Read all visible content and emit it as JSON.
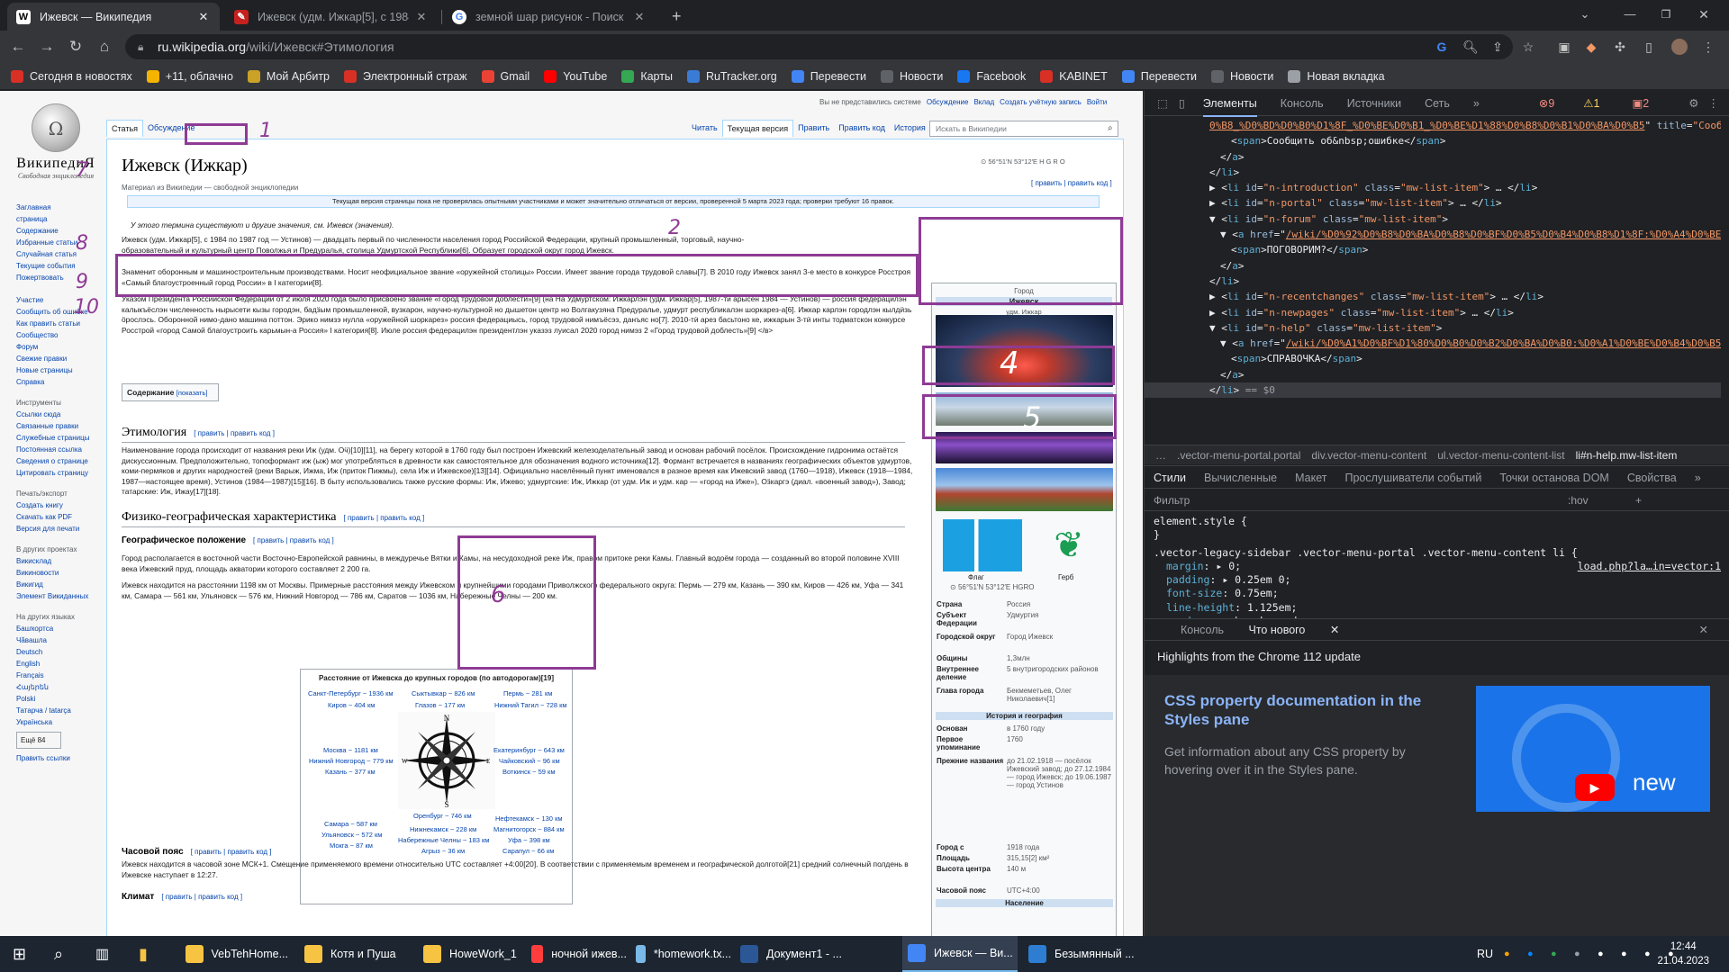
{
  "browser": {
    "tabs": [
      {
        "title": "Ижевск — Википедия",
        "icon": "W",
        "active": true
      },
      {
        "title": "Ижевск (удм. Ижкар[5], с 1984 …",
        "icon": "wiki-edit"
      },
      {
        "title": "земной шар рисунок - Поиск в…",
        "icon": "G"
      }
    ],
    "new_tab": "+",
    "url_host": "ru.wikipedia.org",
    "url_path": "/wiki/Ижевск#Этимология",
    "bookmarks": [
      {
        "label": "Сегодня в новостях",
        "color": "#d93025"
      },
      {
        "label": "+11, облачно",
        "color": "#f4b400"
      },
      {
        "label": "Мой Арбитр",
        "color": "#c9a227"
      },
      {
        "label": "Электронный страж",
        "color": "#d93025"
      },
      {
        "label": "Gmail",
        "color": "#ea4335"
      },
      {
        "label": "YouTube",
        "color": "#ff0000"
      },
      {
        "label": "Карты",
        "color": "#34a853"
      },
      {
        "label": "RuTracker.org",
        "color": "#3a7bd5"
      },
      {
        "label": "Перевести",
        "color": "#4285f4"
      },
      {
        "label": "Новости",
        "color": "#5f6368"
      },
      {
        "label": "Facebook",
        "color": "#1877f2"
      },
      {
        "label": "KABINET",
        "color": "#d93025"
      },
      {
        "label": "Перевести",
        "color": "#4285f4"
      },
      {
        "label": "Новости",
        "color": "#5f6368"
      },
      {
        "label": "Новая вкладка",
        "color": "#9aa0a6"
      }
    ]
  },
  "wiki": {
    "logo_title": "ВикипедиЯ",
    "logo_sub": "Свободная энциклопедия",
    "user_links": [
      "Вы не представились системе",
      "Обсуждение",
      "Вклад",
      "Создать учётную запись",
      "Войти"
    ],
    "tabs_left": [
      "Статья",
      "Обсуждение"
    ],
    "tabs_right": [
      "Читать",
      "Текущая версия",
      "Править",
      "Править код",
      "История"
    ],
    "search_placeholder": "Искать в Википедии",
    "sidebar": {
      "main": [
        "Заглавная",
        "страница",
        "Содержание",
        "Избранные статьи",
        "Случайная статья",
        "Текущие события",
        "Пожертвовать"
      ],
      "part": [
        "Участие",
        "Сообщить об ошибке",
        "Как править статьи",
        "Сообщество",
        "Форум",
        "Свежие правки",
        "Новые страницы",
        "Справка"
      ],
      "tools_h": "Инструменты",
      "tools": [
        "Ссылки сюда",
        "Связанные правки",
        "Служебные страницы",
        "Постоянная ссылка",
        "Сведения о странице",
        "Цитировать страницу"
      ],
      "print_h": "Печать/экспорт",
      "print": [
        "Создать книгу",
        "Скачать как PDF",
        "Версия для печати"
      ],
      "other_h": "В других проектах",
      "other": [
        "Викисклад",
        "Викиновости",
        "Викигид",
        "Элемент Викиданных"
      ],
      "lang_h": "На других языках",
      "langs": [
        "Башҡортса",
        "Чӑвашла",
        "Deutsch",
        "English",
        "Français",
        "Հայերեն",
        "Polski",
        "Татарча / tatarça",
        "Українська"
      ],
      "more": "Ещё 84",
      "edit_links": "Править ссылки"
    },
    "title": "Ижевск",
    "title2": "(Ижкар)",
    "subtitle": "Материал из Википедии — свободной энциклопедии",
    "coords": "56°51′N 53°12′E",
    "edit": "[ править | править код ]",
    "notice": "Текущая версия страницы пока не проверялась опытными участниками и может значительно отличаться от версии, проверенной 5 марта 2023 года; проверки требуют 16 правок.",
    "hatnote": "У этого термина существуют и другие значения, см. Ижевск (значения).",
    "p1": "Ижевск (удм. Ижкар[5], с 1984 по 1987 год — Устинов) — двадцать первый по численности населения город Российской Федерации, крупный промышленный, торговый, научно-образовательный и культурный центр Поволжья и Предуралья, столица Удмуртской Республики[6]. Образует городской округ город Ижевск.",
    "p2": "Знаменит оборонным и машиностроительным производствами. Носит неофициальное звание «оружейной столицы» России. Имеет звание города трудовой славы[7]. В 2010 году Ижевск занял 3-е место в конкурсе Росстроя «Самый благоустроенный город России» в I категории[8].",
    "p3": "Указом Президента Российской Федерации от 2 июля 2020 года было присвоено звание «Город трудовой доблести»[9] (на На Удмуртском: Ижкарлэн (удм. Ижкар[5], 1987-тӥ арысен 1984 — Устинов) — россия федерацилэн калыкъёслэн численность нырысети кызы городэн, бадӟым промышленной, вузкарон, научно-культурной но дышетон центр но Волгакузяна Предуралье, удмурт республикалэн шоркарез-а[6]. Ижкар карлэн городлэн кылдӥзь ӧрослэсь. Оборонной нимо-дано машина поттон. Эрико нимзэ нулла «оружейной шоркарез» россия федерациысь, город трудовой нимъёсэз, данъяс но[7]. 2010-тӥ арез басьтоно ке, ижкарын 3-тӥ инты тодматскон конкурсе Росстрой «город Самой благоустроить карьмын-а Россия» I категория[8]. Июле россия федерацилэн президентлэн указэз луисал 2020 город нимэз 2 «Город трудовой доблесть»[9] </в>",
    "toc": "Содержание",
    "toc_show": "[показать]",
    "h_etym": "Этимология",
    "p_etym": "Наименование города происходит от названия реки Иж (удм. Оӵ)[10][11], на берегу которой в 1760 году был построен Ижевский железоделательный завод и основан рабочий посёлок. Происхождение гидронима остаётся дискуссионным. Предположительно, топоформант иж (ыж) мог употребляться в древности как самостоятельное для обозначения водного источника[12]. Формант встречается в названиях географических объектов удмуртов, коми-пермяков и других народностей (реки Варыж, Ижма, Иж (приток Пижмы), села Иж и Ижевское)[13][14]. Официально населённый пункт именовался в разное время как Ижевский завод (1760—1918), Ижевск (1918—1984, 1987—настоящее время), Устинов (1984—1987)[15][16]. В быту использовались также русские формы: Иж, Ижево; удмуртские: Иж, Ижкар (от удм. Иж и удм. кар — «город на Иже»), Оӟкаргэ (диал. «военный завод»), Завод; татарские: Иж, Ижау[17][18].",
    "h_geo": "Физико-географическая характеристика",
    "h_pos": "Географическое положение",
    "p_pos1": "Город располагается в восточной части Восточно-Европейской равнины, в междуречье Вятки и Камы, на несудоходной реке Иж, правом притоке реки Камы. Главный водоём города — созданный во второй половине XVIII века Ижевский пруд, площадь акватории которого составляет 2 200 га.",
    "p_pos2": "Ижевск находится на расстоянии 1198 км от Москвы. Примерные расстояния между Ижевском и крупнейшими городами Приволжского федерального округа: Пермь — 279 км, Казань — 390 км, Киров — 426 км, Уфа — 341 км, Самара — 561 км, Ульяновск — 576 км, Нижний Новгород — 786 км, Саратов — 1036 км, Набережные Челны — 200 км.",
    "map": {
      "title": "Расстояние от Ижевска до крупных городов (по автодорогам)[19]",
      "cities": [
        [
          "Санкт-Петербург ~ 1936 км",
          8,
          19
        ],
        [
          "Сыктывкар ~ 826 км",
          123,
          19
        ],
        [
          "Пермь ~ 281 км",
          225,
          19
        ],
        [
          "Киров ~ 404 км",
          30,
          32
        ],
        [
          "Глазов ~ 177 км",
          127,
          32
        ],
        [
          "Нижний Тагил ~ 728 км",
          215,
          32
        ],
        [
          "Москва ~ 1181 км",
          25,
          82
        ],
        [
          "Нижний Новгород ~ 779 км",
          9,
          94
        ],
        [
          "Казань ~ 377 км",
          27,
          106
        ],
        [
          "Екатеринбург ~ 643 км",
          214,
          82
        ],
        [
          "Чайковский ~ 96 км",
          220,
          94
        ],
        [
          "Воткинск ~ 59 км",
          224,
          106
        ],
        [
          "Оренбург ~ 746 км",
          125,
          155
        ],
        [
          "Нефтекамск ~ 130 км",
          216,
          158
        ],
        [
          "Самара ~ 587 км",
          26,
          164
        ],
        [
          "Нижнекамск ~ 228 км",
          121,
          170
        ],
        [
          "Магнитогорск ~ 884 км",
          214,
          170
        ],
        [
          "Ульяновск ~ 572 км",
          23,
          176
        ],
        [
          "Набережные Челны ~ 183 км",
          108,
          182
        ],
        [
          "Уфа ~ 398 км",
          230,
          182
        ],
        [
          "Мокга ~ 87 км",
          32,
          188
        ],
        [
          "Агрыз ~ 36 км",
          134,
          194
        ],
        [
          "Сарапул ~ 66 км",
          224,
          194
        ]
      ],
      "compass": [
        "N",
        "S",
        "W",
        "E"
      ]
    },
    "h_tz": "Часовой пояс",
    "p_tz": "Ижевск находится в часовой зоне МСК+1. Смещение применяемого времени относительно UTC составляет +4:00[20]. В соответствии с применяемым временем и географической долготой[21] средний солнечный полдень в Ижевске наступает в 12:27.",
    "h_clim": "Климат",
    "infobox": {
      "kind": "Город",
      "name": "Ижевск",
      "native": "удм. Ижкар",
      "flag": "Флаг",
      "coa": "Герб",
      "coords": "56°51′N 53°12′E",
      "rows1": [
        [
          "Страна",
          "Россия"
        ],
        [
          "Субъект Федерации",
          "Удмуртия"
        ],
        [
          "Городской округ",
          "Город Ижевск"
        ],
        [
          "Общины",
          "1,3млн"
        ],
        [
          "Внутреннее деление",
          "5 внутригородских районов"
        ],
        [
          "Глава города",
          "Бекмеметьев, Олег Николаевич[1]"
        ]
      ],
      "sec": "История и география",
      "rows2": [
        [
          "Основан",
          "в 1760 году"
        ],
        [
          "Первое упоминание",
          "1760"
        ],
        [
          "Прежние названия",
          "до 21.02.1918 — посёлок Ижевский завод; до 27.12.1984 — город Ижевск; до 19.06.1987 — город Устинов"
        ],
        [
          "Город с",
          "1918 года"
        ],
        [
          "Площадь",
          "315,15[2] км²"
        ],
        [
          "Высота центра",
          "140 м"
        ],
        [
          "Часовой пояс",
          "UTC+4:00"
        ]
      ],
      "sec2": "Население"
    },
    "annotations": [
      "1",
      "7",
      "8",
      "9",
      "10",
      "2",
      "3",
      "4",
      "5",
      "6"
    ]
  },
  "devtools": {
    "tabs": [
      "Элементы",
      "Консоль",
      "Источники",
      "Сеть"
    ],
    "errors": "9",
    "warnings": "1",
    "issues": "2",
    "breadcrumbs": [
      "…",
      ".vector-menu-portal.portal",
      "div.vector-menu-content",
      "ul.vector-menu-content-list",
      "li#n-help.mw-list-item"
    ],
    "subtabs": [
      "Стили",
      "Вычисленные",
      "Макет",
      "Прослушиватели событий",
      "Точки останова DOM",
      "Свойства"
    ],
    "filter": "Фильтр",
    "hov": ":hov",
    ".cls": ".cls",
    "tree": [
      {
        "i": 72,
        "h": "<span class=\"lnk\">0%B8_%D0%BD%D0%B0%D1%8F_%D0%BE%D0%B1_%D0%BE%D1%88%D0%B8%D0%B1%D0%BA%D0%B5</span>\" <span class=\"attr\">title</span>=<span class=\"val\">\"Сообщить об ошибке в этой статье\"</span>&gt;"
      },
      {
        "i": 96,
        "h": "&lt;<span class=\"tag\">span</span>&gt;Сообщить об&amp;nbsp;ошибке&lt;/<span class=\"tag\">span</span>&gt;"
      },
      {
        "i": 84,
        "h": "&lt;/<span class=\"tag\">a</span>&gt;"
      },
      {
        "i": 72,
        "h": "&lt;/<span class=\"tag\">li</span>&gt;"
      },
      {
        "i": 72,
        "h": "▶ &lt;<span class=\"tag\">li</span> <span class=\"attr\">id</span>=<span class=\"val\">\"n-introduction\"</span> <span class=\"attr\">class</span>=<span class=\"val\">\"mw-list-item\"</span>&gt; … &lt;/<span class=\"tag\">li</span>&gt;"
      },
      {
        "i": 72,
        "h": "▶ &lt;<span class=\"tag\">li</span> <span class=\"attr\">id</span>=<span class=\"val\">\"n-portal\"</span> <span class=\"attr\">class</span>=<span class=\"val\">\"mw-list-item\"</span>&gt; … &lt;/<span class=\"tag\">li</span>&gt;"
      },
      {
        "i": 72,
        "h": "▼ &lt;<span class=\"tag\">li</span> <span class=\"attr\">id</span>=<span class=\"val\">\"n-forum\"</span> <span class=\"attr\">class</span>=<span class=\"val\">\"mw-list-item\"</span>&gt;"
      },
      {
        "i": 84,
        "h": "▼ &lt;<span class=\"tag\">a</span> <span class=\"attr\">href</span>=\"<span class=\"lnk\">/wiki/%D0%92%D0%B8%D0%BA%D0%B8%D0%BF%D0%B5%D0%B4%D0%B8%D1%8F:%D0%A4%D0%BE%D1%80%D1%83%D0%BC</span>\" <span class=\"attr\">title</span>=<span class=\"val\">\"Форум участников Википедии\"</span>&gt;"
      },
      {
        "i": 96,
        "h": "&lt;<span class=\"tag\">span</span>&gt;ПОГОВОРИМ?&lt;/<span class=\"tag\">span</span>&gt;"
      },
      {
        "i": 84,
        "h": "&lt;/<span class=\"tag\">a</span>&gt;"
      },
      {
        "i": 72,
        "h": "&lt;/<span class=\"tag\">li</span>&gt;"
      },
      {
        "i": 72,
        "h": "▶ &lt;<span class=\"tag\">li</span> <span class=\"attr\">id</span>=<span class=\"val\">\"n-recentchanges\"</span> <span class=\"attr\">class</span>=<span class=\"val\">\"mw-list-item\"</span>&gt; … &lt;/<span class=\"tag\">li</span>&gt;"
      },
      {
        "i": 72,
        "h": "▶ &lt;<span class=\"tag\">li</span> <span class=\"attr\">id</span>=<span class=\"val\">\"n-newpages\"</span> <span class=\"attr\">class</span>=<span class=\"val\">\"mw-list-item\"</span>&gt; … &lt;/<span class=\"tag\">li</span>&gt;"
      },
      {
        "i": 72,
        "h": "▼ &lt;<span class=\"tag\">li</span> <span class=\"attr\">id</span>=<span class=\"val\">\"n-help\"</span> <span class=\"attr\">class</span>=<span class=\"val\">\"mw-list-item\"</span>&gt;"
      },
      {
        "i": 84,
        "h": "▼ &lt;<span class=\"tag\">a</span> <span class=\"attr\">href</span>=\"<span class=\"lnk\">/wiki/%D0%A1%D0%BF%D1%80%D0%B0%D0%B2%D0%BA%D0%B0:%D0%A1%D0%BE%D0%B4%D0%B5%D1%80%D0%B6%D0%B0%D0%BD%D0%B8%D0%B5</span>\" <span class=\"attr\">title</span>=<span class=\"val\">\"Место расположения Справки\"</span>&gt;"
      },
      {
        "i": 96,
        "h": "&lt;<span class=\"tag\">span</span>&gt;СПРАВОЧКА&lt;/<span class=\"tag\">span</span>&gt;"
      },
      {
        "i": 84,
        "h": "&lt;/<span class=\"tag\">a</span>&gt;"
      },
      {
        "i": 72,
        "h": "&lt;/<span class=\"tag\">li</span>&gt; <span class=\"g\">== $0</span>",
        "sel": true
      }
    ],
    "drawer_tabs": [
      "Консоль",
      "Что нового"
    ],
    "highlights": "Highlights from the Chrome 112 update",
    "css_doc_title": "CSS property documentation in the Styles pane",
    "css_doc_sub": "Get information about any CSS property by hovering over it in the Styles pane.",
    "new": "new"
  },
  "taskbar": {
    "items": [
      {
        "label": "VebTehHome...",
        "color": "#f6c343"
      },
      {
        "label": "Котя и Пуша",
        "color": "#f6c343"
      },
      {
        "label": "HoweWork_1",
        "color": "#f6c343"
      },
      {
        "label": "ночной ижев...",
        "color": "#ff3d3d"
      },
      {
        "label": "*homework.tx...",
        "color": "#7ab8e8"
      },
      {
        "label": "Документ1 - ...",
        "color": "#2b5797"
      },
      {
        "label": "Ижевск — Ви...",
        "color": "#4285f4"
      },
      {
        "label": "Безымянный ...",
        "color": "#2d7dd2"
      }
    ],
    "lang": "RU",
    "time": "12:44",
    "date": "21.04.2023"
  }
}
